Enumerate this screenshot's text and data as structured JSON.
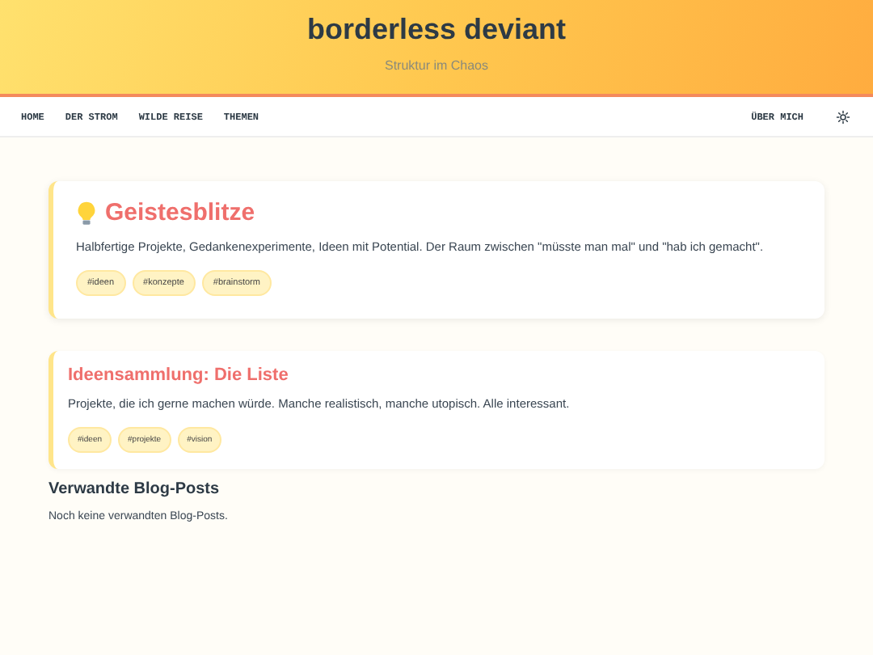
{
  "header": {
    "title": "borderless deviant",
    "subtitle": "Struktur im Chaos"
  },
  "nav": {
    "left": [
      "HOME",
      "DER STROM",
      "WILDE REISE",
      "THEMEN"
    ],
    "right": [
      "ÜBER MICH"
    ]
  },
  "cards": [
    {
      "kind": "hero",
      "title": "Geistesblitze",
      "text": "Halbfertige Projekte, Gedankenexperimente, Ideen mit Potential. Der Raum zwischen \"müsste man mal\" und \"hab ich gemacht\".",
      "tags": [
        "#ideen",
        "#konzepte",
        "#brainstorm"
      ]
    },
    {
      "kind": "post",
      "title": "Ideensammlung: Die Liste",
      "text": "Projekte, die ich gerne machen würde. Manche realistisch, manche utopisch. Alle interessant.",
      "tags": [
        "#ideen",
        "#projekte",
        "#vision"
      ]
    }
  ],
  "related": {
    "heading": "Verwandte Blog-Posts",
    "text": "Noch keine verwandten Blog-Posts."
  }
}
